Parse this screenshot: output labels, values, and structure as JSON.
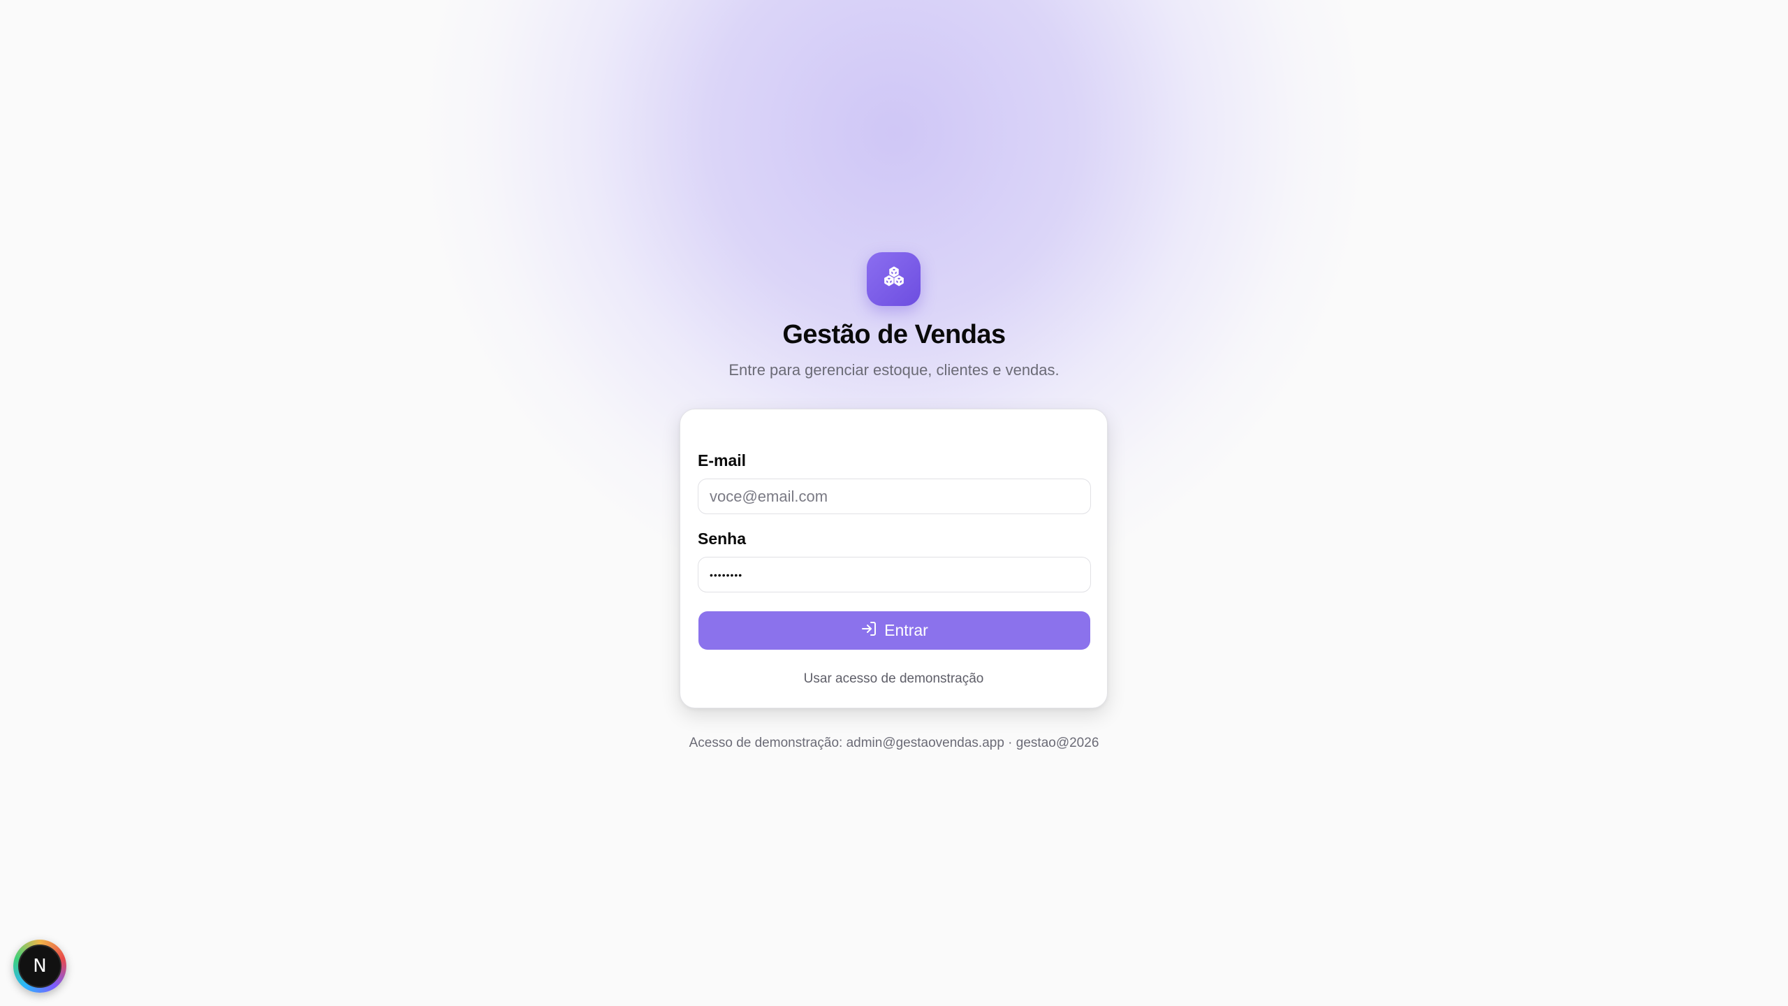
{
  "app": {
    "title": "Gestão de Vendas",
    "subtitle": "Entre para gerenciar estoque, clientes e vendas.",
    "logo_icon": "boxes-icon",
    "accent_color": "#8b72ec"
  },
  "login_form": {
    "email_label": "E-mail",
    "email_value": "",
    "email_placeholder": "voce@email.com",
    "password_label": "Senha",
    "password_value": "••••••••",
    "submit_label": "Entrar",
    "submit_icon": "log-in-icon",
    "demo_link_label": "Usar acesso de demonstração"
  },
  "footer": {
    "demo_credentials": "Acesso de demonstração: admin@gestaovendas.app · gestao@2026"
  },
  "dev_badge": {
    "label": "N",
    "icon": "nextjs-icon"
  }
}
